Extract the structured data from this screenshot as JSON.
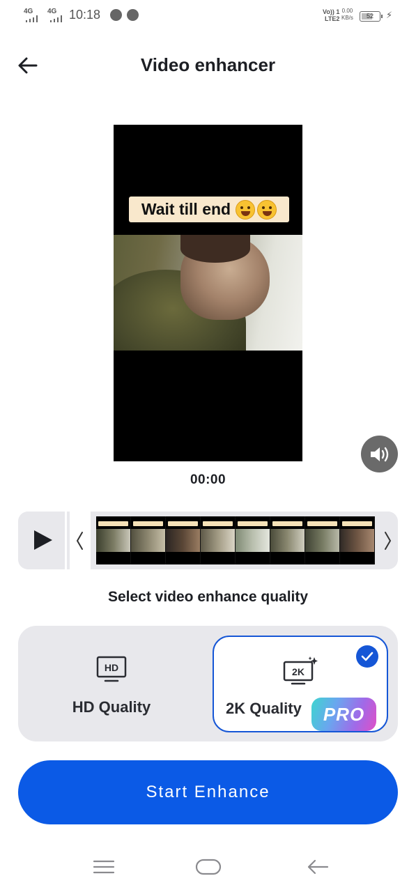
{
  "status_bar": {
    "network_1": "4G",
    "network_2": "4G",
    "time": "10:18",
    "volte_line1": "Vo)) 1",
    "volte_line2": "LTE2",
    "speed_value": "0.00",
    "speed_unit": "KB/s",
    "battery": "52"
  },
  "header": {
    "title": "Video enhancer",
    "back_icon": "arrow-left-icon"
  },
  "video": {
    "caption": "Wait till end",
    "caption_emojis": [
      "laughing-tears-emoji",
      "sweat-smile-emoji"
    ],
    "timecode": "00:00",
    "volume_icon": "speaker-icon"
  },
  "timeline": {
    "play_icon": "play-icon",
    "trim_left_icon": "chevron-left-icon",
    "trim_right_icon": "chevron-right-icon",
    "thumbnail_caption": "Wait till end"
  },
  "quality": {
    "heading": "Select video enhance quality",
    "options": [
      {
        "label": "HD Quality",
        "icon": "hd-monitor-icon",
        "badge_text": "HD",
        "selected": false
      },
      {
        "label": "2K Quality",
        "icon": "2k-monitor-sparkle-icon",
        "badge_text": "2K",
        "selected": true,
        "pro_badge": "PRO"
      }
    ]
  },
  "cta": {
    "label": "Start Enhance"
  },
  "colors": {
    "accent": "#0b5ae6",
    "selected_border": "#1556d6",
    "panel_bg": "#e8e8ec",
    "text_primary": "#1d1f24"
  },
  "nav_bar": {
    "items": [
      "menu-icon",
      "home-icon",
      "back-icon"
    ]
  }
}
